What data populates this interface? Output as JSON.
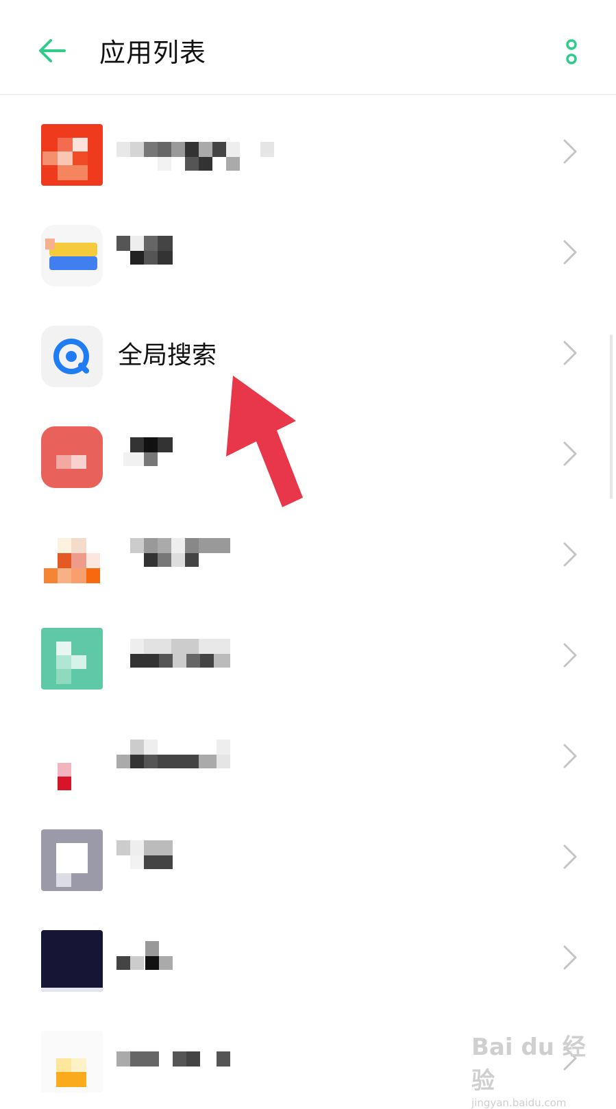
{
  "header": {
    "title": "应用列表",
    "back_icon": "arrow-left-icon",
    "more_icon": "more-vertical-icon",
    "accent": "#2ecc8a"
  },
  "rows": [
    {
      "label": "",
      "icon": "app-icon-red"
    },
    {
      "label": "",
      "icon": "app-icon-yellow-blue"
    },
    {
      "label": "全局搜索",
      "icon": "global-search-icon"
    },
    {
      "label": "",
      "icon": "app-icon-coral"
    },
    {
      "label": "",
      "icon": "app-icon-orange"
    },
    {
      "label": "",
      "icon": "app-icon-teal"
    },
    {
      "label": "",
      "icon": "app-icon-red-small"
    },
    {
      "label": "",
      "icon": "app-icon-gray-square"
    },
    {
      "label": "",
      "icon": "app-icon-navy"
    },
    {
      "label": "",
      "icon": "app-icon-yellow"
    }
  ],
  "colors": {
    "chevron": "#c4c4c4",
    "annotation_arrow": "#e8374b"
  },
  "watermark": {
    "top": "Bai du 经验",
    "bottom": "jingyan.baidu.com"
  }
}
